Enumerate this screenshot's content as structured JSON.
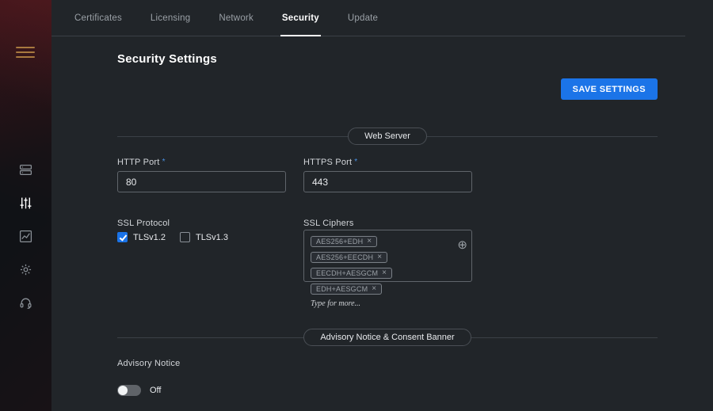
{
  "sidebar": {
    "icons": [
      "menu-icon",
      "appliance-icon",
      "settings-sliders-icon",
      "reports-chart-icon",
      "system-gear-icon",
      "support-headset-icon"
    ],
    "active_icon": "settings-sliders-icon"
  },
  "tabs": [
    {
      "label": "Certificates",
      "active": false
    },
    {
      "label": "Licensing",
      "active": false
    },
    {
      "label": "Network",
      "active": false
    },
    {
      "label": "Security",
      "active": true
    },
    {
      "label": "Update",
      "active": false
    }
  ],
  "page": {
    "title": "Security Settings",
    "save_button": "SAVE SETTINGS"
  },
  "sections": {
    "web_server": "Web Server",
    "advisory": "Advisory Notice & Consent Banner"
  },
  "form": {
    "http_port": {
      "label": "HTTP Port",
      "required": "*",
      "value": "80"
    },
    "https_port": {
      "label": "HTTPS Port",
      "required": "*",
      "value": "443"
    },
    "ssl_protocol": {
      "label": "SSL Protocol",
      "options": [
        {
          "label": "TLSv1.2",
          "checked": true
        },
        {
          "label": "TLSv1.3",
          "checked": false
        }
      ]
    },
    "ssl_ciphers": {
      "label": "SSL Ciphers",
      "chips": [
        "AES256+EDH",
        "AES256+EECDH",
        "EECDH+AESGCM",
        "EDH+AESGCM"
      ],
      "remove_icon": "×",
      "add_icon": "⊕",
      "placeholder": "Type for more..."
    }
  },
  "advisory": {
    "label": "Advisory Notice",
    "toggle_state": "Off"
  },
  "colors": {
    "accent_blue": "#1b74e8",
    "background": "#212529",
    "sidebar": "#101216"
  }
}
